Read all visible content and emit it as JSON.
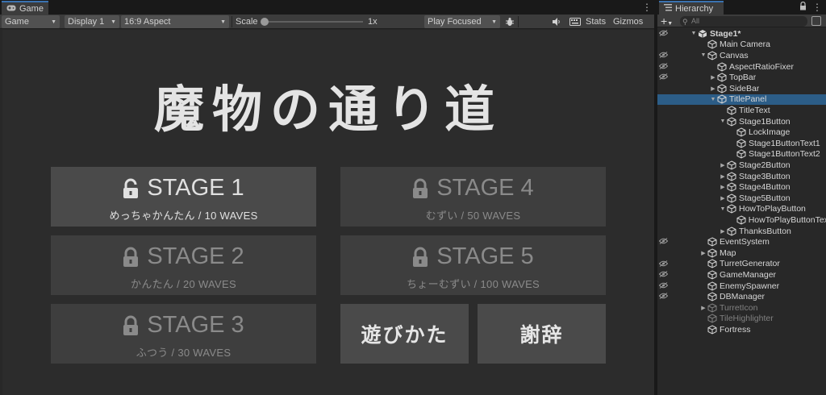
{
  "game_panel": {
    "tab_title": "Game",
    "toolbar": {
      "mode": "Game",
      "display": "Display 1",
      "aspect": "16:9 Aspect",
      "scale_label": "Scale",
      "scale_value": "1x",
      "play_mode": "Play Focused",
      "stats_label": "Stats",
      "gizmos_label": "Gizmos"
    },
    "view": {
      "title": "魔物の通り道",
      "stages": [
        {
          "label": "STAGE 1",
          "sub": "めっちゃかんたん / 10 WAVES",
          "locked": false
        },
        {
          "label": "STAGE 2",
          "sub": "かんたん / 20 WAVES",
          "locked": true
        },
        {
          "label": "STAGE 3",
          "sub": "ふつう / 30 WAVES",
          "locked": true
        },
        {
          "label": "STAGE 4",
          "sub": "むずい / 50 WAVES",
          "locked": true
        },
        {
          "label": "STAGE 5",
          "sub": "ちょーむずい / 100 WAVES",
          "locked": true
        }
      ],
      "howto_label": "遊びかた",
      "thanks_label": "謝辞"
    }
  },
  "hierarchy_panel": {
    "tab_title": "Hierarchy",
    "search_placeholder": "All",
    "add_label": "+",
    "items": [
      {
        "label": "Stage1*",
        "depth": 0,
        "fold": "open",
        "icon": "scene-icon",
        "bold": true
      },
      {
        "label": "Main Camera",
        "depth": 1,
        "fold": "none",
        "icon": "gameobject-icon"
      },
      {
        "label": "Canvas",
        "depth": 1,
        "fold": "open",
        "icon": "gameobject-icon"
      },
      {
        "label": "AspectRatioFixer",
        "depth": 2,
        "fold": "none",
        "icon": "gameobject-icon"
      },
      {
        "label": "TopBar",
        "depth": 2,
        "fold": "closed",
        "icon": "gameobject-icon"
      },
      {
        "label": "SideBar",
        "depth": 2,
        "fold": "closed",
        "icon": "gameobject-icon"
      },
      {
        "label": "TitlePanel",
        "depth": 2,
        "fold": "open",
        "icon": "gameobject-icon",
        "selected": true
      },
      {
        "label": "TitleText",
        "depth": 3,
        "fold": "none",
        "icon": "gameobject-icon"
      },
      {
        "label": "Stage1Button",
        "depth": 3,
        "fold": "open",
        "icon": "gameobject-icon"
      },
      {
        "label": "LockImage",
        "depth": 4,
        "fold": "none",
        "icon": "gameobject-icon"
      },
      {
        "label": "Stage1ButtonText1",
        "depth": 4,
        "fold": "none",
        "icon": "gameobject-icon"
      },
      {
        "label": "Stage1ButtonText2",
        "depth": 4,
        "fold": "none",
        "icon": "gameobject-icon"
      },
      {
        "label": "Stage2Button",
        "depth": 3,
        "fold": "closed",
        "icon": "gameobject-icon"
      },
      {
        "label": "Stage3Button",
        "depth": 3,
        "fold": "closed",
        "icon": "gameobject-icon"
      },
      {
        "label": "Stage4Button",
        "depth": 3,
        "fold": "closed",
        "icon": "gameobject-icon"
      },
      {
        "label": "Stage5Button",
        "depth": 3,
        "fold": "closed",
        "icon": "gameobject-icon"
      },
      {
        "label": "HowToPlayButton",
        "depth": 3,
        "fold": "open",
        "icon": "gameobject-icon"
      },
      {
        "label": "HowToPlayButtonTex",
        "depth": 4,
        "fold": "none",
        "icon": "gameobject-icon"
      },
      {
        "label": "ThanksButton",
        "depth": 3,
        "fold": "closed",
        "icon": "gameobject-icon"
      },
      {
        "label": "EventSystem",
        "depth": 1,
        "fold": "none",
        "icon": "gameobject-icon"
      },
      {
        "label": "Map",
        "depth": 1,
        "fold": "closed",
        "icon": "gameobject-icon"
      },
      {
        "label": "TurretGenerator",
        "depth": 1,
        "fold": "none",
        "icon": "gameobject-icon"
      },
      {
        "label": "GameManager",
        "depth": 1,
        "fold": "none",
        "icon": "gameobject-icon"
      },
      {
        "label": "EnemySpawner",
        "depth": 1,
        "fold": "none",
        "icon": "gameobject-icon"
      },
      {
        "label": "DBManager",
        "depth": 1,
        "fold": "none",
        "icon": "gameobject-icon"
      },
      {
        "label": "TurretIcon",
        "depth": 1,
        "fold": "closed",
        "icon": "gameobject-icon",
        "disabled": true
      },
      {
        "label": "TileHighlighter",
        "depth": 1,
        "fold": "none",
        "icon": "gameobject-icon",
        "disabled": true
      },
      {
        "label": "Fortress",
        "depth": 1,
        "fold": "none",
        "icon": "gameobject-icon"
      }
    ]
  },
  "colors": {
    "selection": "#2c5d87",
    "panel_bg": "#282828",
    "button_unlocked": "#4a4a4a",
    "button_locked": "#3e3e3e"
  }
}
